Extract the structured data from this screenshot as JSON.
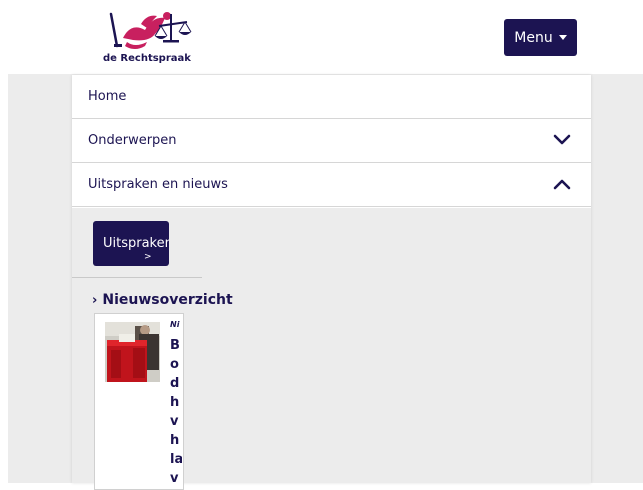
{
  "header": {
    "logo_text": "de Rechtspraak",
    "menu_label": "Menu"
  },
  "nav": {
    "items": [
      {
        "label": "Home"
      },
      {
        "label": "Onderwerpen"
      },
      {
        "label": "Uitspraken en nieuws"
      }
    ]
  },
  "submenu": {
    "button_label": "Uitspraken",
    "button_arrow": ">",
    "news_arrow": "›",
    "news_heading": "Nieuwsoverzicht"
  },
  "news_card": {
    "meta": "Ni",
    "title_lines": [
      "B",
      "o",
      "d",
      "h",
      "v",
      "h",
      "la",
      "v"
    ]
  },
  "colors": {
    "brand_navy": "#1c1452",
    "brand_magenta": "#c8205f",
    "page_gray": "#ececec"
  }
}
